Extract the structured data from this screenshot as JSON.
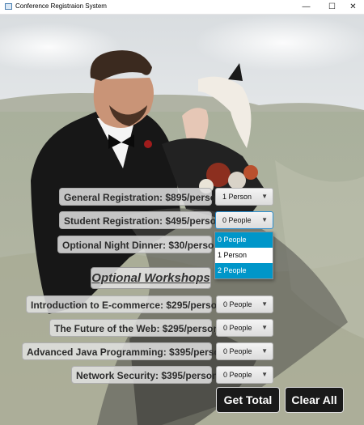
{
  "window": {
    "title": "Conference Registraion System",
    "controls": {
      "minimize": "—",
      "maximize": "☐",
      "close": "✕"
    }
  },
  "rows": {
    "general": {
      "label": "General Registration: $895/person",
      "value": "1 Person"
    },
    "student": {
      "label": "Student Registration: $495/person",
      "value": "0 People"
    },
    "dinner": {
      "label": "Optional Night Dinner: $30/person"
    },
    "ecommerce": {
      "label": "Introduction to E-commerce: $295/person",
      "value": "0 People"
    },
    "web": {
      "label": "The Future of the Web: $295/person",
      "value": "0 People"
    },
    "java": {
      "label": "Advanced Java Programming: $395/person",
      "value": "0 People"
    },
    "security": {
      "label": "Network Security: $395/person",
      "value": "0 People"
    }
  },
  "dropdown": {
    "options": [
      "0 People",
      "1 Person",
      "2 People"
    ]
  },
  "workshops_heading": "Optional Workshops",
  "buttons": {
    "total": "Get Total",
    "clear": "Clear All"
  },
  "icons": {
    "dropdown_arrow": "▼"
  },
  "colors": {
    "selected_option": "#0096c9",
    "button_bg": "#1a1a1a"
  }
}
